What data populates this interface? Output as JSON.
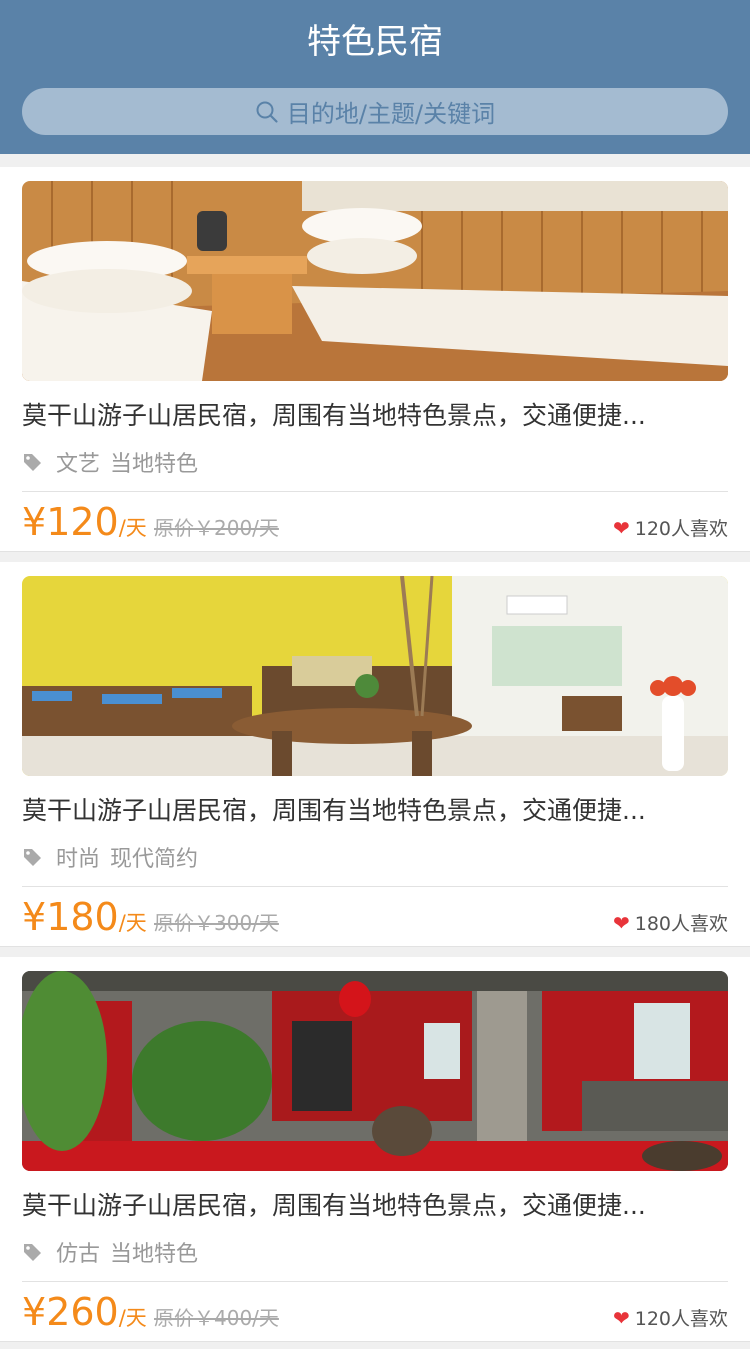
{
  "header": {
    "title": "特色民宿"
  },
  "search": {
    "placeholder": "目的地/主题/关键词"
  },
  "listings": [
    {
      "title": "莫干山游子山居民宿，周围有当地特色景点，交通便捷...",
      "tags": [
        "文艺",
        "当地特色"
      ],
      "currency": "¥",
      "price": "120",
      "unit": "/天",
      "original": "原价￥200/天",
      "likes": "120人喜欢",
      "photo": "wooden-bedroom-photo"
    },
    {
      "title": "莫干山游子山居民宿，周围有当地特色景点，交通便捷...",
      "tags": [
        "时尚",
        "现代简约"
      ],
      "currency": "¥",
      "price": "180",
      "unit": "/天",
      "original": "原价￥300/天",
      "likes": "180人喜欢",
      "photo": "yellow-lounge-photo"
    },
    {
      "title": "莫干山游子山居民宿，周围有当地特色景点，交通便捷...",
      "tags": [
        "仿古",
        "当地特色"
      ],
      "currency": "¥",
      "price": "260",
      "unit": "/天",
      "original": "原价￥400/天",
      "likes": "120人喜欢",
      "photo": "red-courtyard-photo"
    }
  ],
  "icons": {
    "search": "search-icon",
    "tag": "tag-icon",
    "heart": "heart-icon"
  },
  "colors": {
    "header": "#5a82a8",
    "price": "#f48a1a",
    "heart": "#e8343a"
  }
}
